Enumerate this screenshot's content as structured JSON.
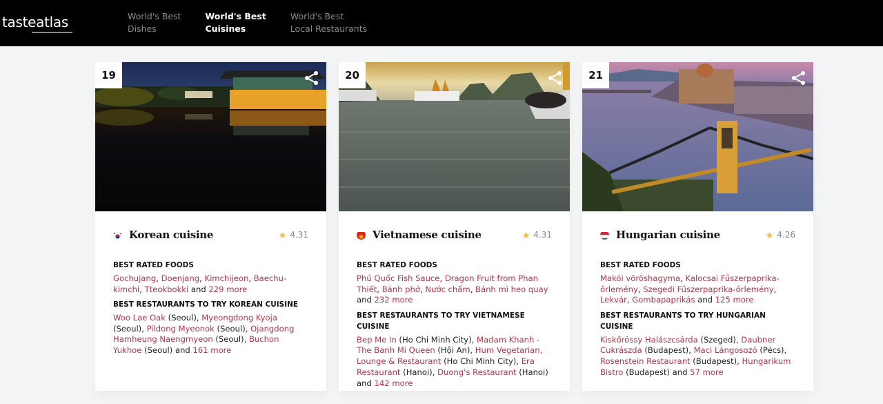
{
  "header": {
    "logo_part1": "taste",
    "logo_part2": "atlas",
    "nav": [
      {
        "line1": "World's Best",
        "line2": "Dishes",
        "active": false
      },
      {
        "line1": "World's Best",
        "line2": "Cuisines",
        "active": true
      },
      {
        "line1": "World's Best",
        "line2": "Local Restaurants",
        "active": false
      }
    ]
  },
  "colors": {
    "link": "#a8394b",
    "star": "#f5c04a",
    "header_bg": "#000000"
  },
  "cards": [
    {
      "rank": "19",
      "title": "Korean cuisine",
      "flag": "south-korea",
      "rating": "4.31",
      "foods_heading": "BEST RATED FOODS",
      "foods": [
        "Gochujang",
        "Doenjang",
        "Kimchijeon",
        "Baechu-kimchi",
        "Tteokbokki"
      ],
      "foods_and": "and",
      "foods_more": "229 more",
      "restaurants_heading": "BEST RESTAURANTS TO TRY KOREAN CUISINE",
      "restaurants": [
        {
          "name": "Woo Lae Oak",
          "city": "(Seoul)"
        },
        {
          "name": "Myeongdong Kyoja",
          "city": "(Seoul)"
        },
        {
          "name": "Pildong Myeonok",
          "city": "(Seoul)"
        },
        {
          "name": "Ojangdong Hamheung Naengmyeon",
          "city": "(Seoul)"
        },
        {
          "name": "Buchon Yukhoe",
          "city": "(Seoul)"
        }
      ],
      "restaurants_and": "and",
      "restaurants_more": "161 more"
    },
    {
      "rank": "20",
      "title": "Vietnamese cuisine",
      "flag": "vietnam",
      "rating": "4.31",
      "foods_heading": "BEST RATED FOODS",
      "foods": [
        "Phú Quốc Fish Sauce",
        "Dragon Fruit from Phan Thiết",
        "Bánh phở",
        "Nước chấm",
        "Bánh mì heo quay"
      ],
      "foods_and": "and",
      "foods_more": "232 more",
      "restaurants_heading": "BEST RESTAURANTS TO TRY VIETNAMESE CUISINE",
      "restaurants": [
        {
          "name": "Bep Me In",
          "city": "(Ho Chi Minh City)"
        },
        {
          "name": "Madam Khanh - The Banh Mi Queen",
          "city": "(Hội An)"
        },
        {
          "name": "Hum Vegetarian, Lounge & Restaurant",
          "city": "(Ho Chi Minh City)"
        },
        {
          "name": "Era Restaurant",
          "city": "(Hanoi)"
        },
        {
          "name": "Duong's Restaurant",
          "city": "(Hanoi)"
        }
      ],
      "restaurants_and": "and",
      "restaurants_more": "142 more"
    },
    {
      "rank": "21",
      "title": "Hungarian cuisine",
      "flag": "hungary",
      "rating": "4.26",
      "foods_heading": "BEST RATED FOODS",
      "foods": [
        "Makói vöröshagyma",
        "Kalocsai Fűszerpaprika-őrlemény",
        "Szegedi Fűszerpaprika-őrlemény",
        "Lekvár",
        "Gombapaprikás"
      ],
      "foods_and": "and",
      "foods_more": "125 more",
      "restaurants_heading": "BEST RESTAURANTS TO TRY HUNGARIAN CUISINE",
      "restaurants": [
        {
          "name": "Kiskőrössy Halászcsárda",
          "city": "(Szeged)"
        },
        {
          "name": "Daubner Cukrászda",
          "city": "(Budapest)"
        },
        {
          "name": "Maci Lángosozó",
          "city": "(Pécs)"
        },
        {
          "name": "Rosenstein Restaurant",
          "city": "(Budapest)"
        },
        {
          "name": "Hungarikum Bistro",
          "city": "(Budapest)"
        }
      ],
      "restaurants_and": "and",
      "restaurants_more": "57 more"
    }
  ]
}
